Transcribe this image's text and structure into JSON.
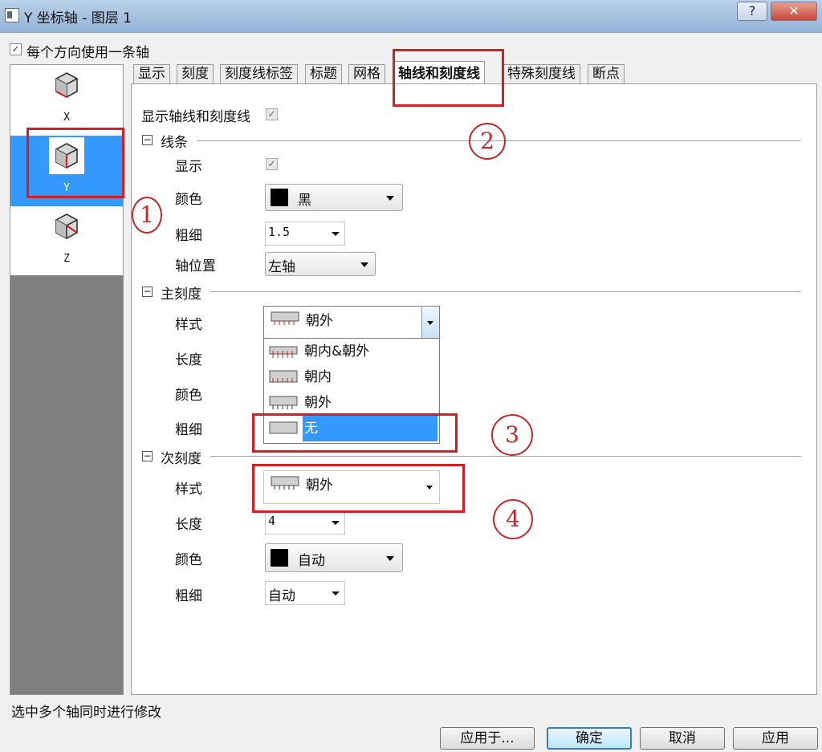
{
  "window": {
    "title": "Y 坐标轴 - 图层 1",
    "help_label": "?",
    "close_label": "✕"
  },
  "one_axis_per_direction": {
    "label": "每个方向使用一条轴",
    "checked": true
  },
  "axes": [
    {
      "label": "X",
      "icon": "cube-x-icon"
    },
    {
      "label": "Y",
      "icon": "cube-y-icon",
      "selected": true
    },
    {
      "label": "Z",
      "icon": "cube-z-icon"
    }
  ],
  "tabs": [
    "显示",
    "刻度",
    "刻度线标签",
    "标题",
    "网格",
    "轴线和刻度线",
    "特殊刻度线",
    "断点"
  ],
  "active_tab": "轴线和刻度线",
  "panel": {
    "show_axes_ticks": "显示轴线和刻度线",
    "line": {
      "section": "线条",
      "show_label": "显示",
      "color_label": "颜色",
      "color_value": "黑",
      "thickness_label": "粗细",
      "thickness_value": "1.5",
      "position_label": "轴位置",
      "position_value": "左轴"
    },
    "major": {
      "section": "主刻度",
      "style_label": "样式",
      "style_value": "朝外",
      "length_label": "长度",
      "color_label": "颜色",
      "thickness_label": "粗细",
      "options": [
        "朝内&朝外",
        "朝内",
        "朝外",
        "无"
      ],
      "highlighted": "无"
    },
    "minor": {
      "section": "次刻度",
      "style_label": "样式",
      "style_value": "朝外",
      "length_label": "长度",
      "length_value": "4",
      "color_label": "颜色",
      "color_value": "自动",
      "thickness_label": "粗细",
      "thickness_value": "自动"
    }
  },
  "annotations": [
    "1",
    "2",
    "3",
    "4"
  ],
  "annotation_color": "#d21f26",
  "status_text": "选中多个轴同时进行修改",
  "buttons": {
    "apply_to": "应用于...",
    "ok": "确定",
    "cancel": "取消",
    "apply": "应用"
  },
  "colors": {
    "selection": "#3399ff",
    "black_swatch": "#000000"
  }
}
